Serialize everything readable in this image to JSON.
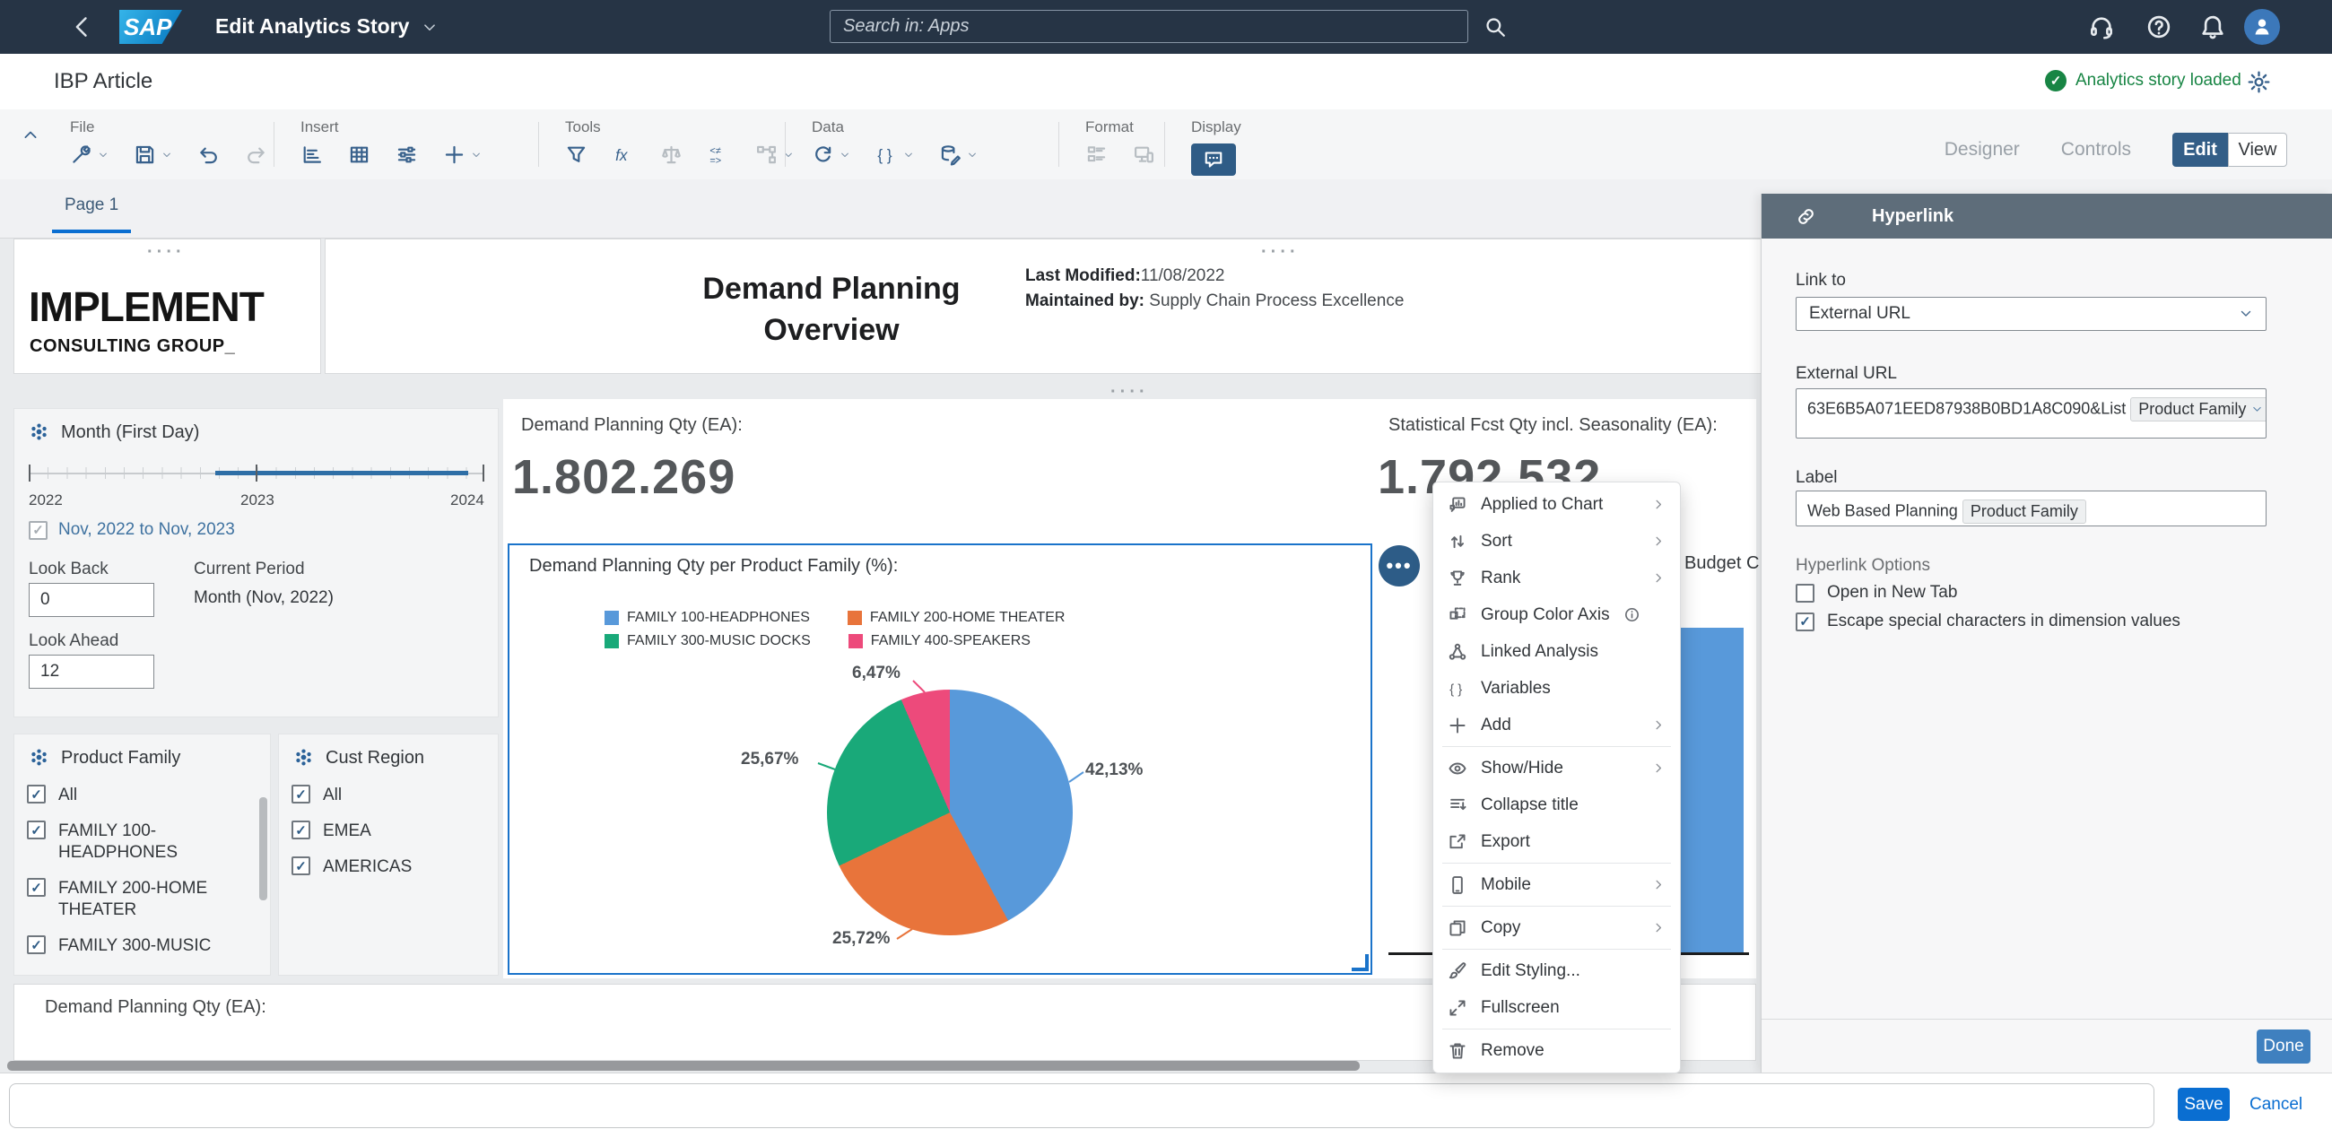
{
  "shell": {
    "title": "Edit Analytics Story",
    "search_placeholder": "Search in: Apps"
  },
  "header": {
    "story_title": "IBP Article",
    "status": "Analytics story loaded"
  },
  "toolbar": {
    "file": "File",
    "insert": "Insert",
    "tools": "Tools",
    "data": "Data",
    "format": "Format",
    "display": "Display",
    "designer": "Designer",
    "controls": "Controls",
    "edit": "Edit",
    "view": "View"
  },
  "tabs": {
    "page1": "Page 1"
  },
  "canvas": {
    "logo_line1": "IMPLEMENT",
    "logo_line2": "CONSULTING GROUP_",
    "title": "Demand Planning Overview",
    "last_modified_label": "Last Modified:",
    "last_modified_value": "11/08/2022",
    "maintained_label": "Maintained by:",
    "maintained_value": "Supply Chain Process Excellence",
    "kpi_left_label": "Demand Planning Qty (EA):",
    "kpi_left_value": "1.802.269",
    "kpi_right_label": "Statistical Fcst Qty incl. Seasonality (EA):",
    "kpi_right_value": "1.792.532",
    "partial_widget_title": "Budget C",
    "bottom_widget_title": "Demand Planning Qty (EA):"
  },
  "filters": {
    "month": {
      "title": "Month (First Day)",
      "ticks": [
        "2022",
        "2023",
        "2024"
      ],
      "range_label": "Nov, 2022 to Nov, 2023",
      "look_back_label": "Look Back",
      "look_back_value": "0",
      "current_period_label": "Current Period",
      "current_period_value": "Month (Nov, 2022)",
      "look_ahead_label": "Look Ahead",
      "look_ahead_value": "12"
    },
    "product_family": {
      "title": "Product Family",
      "items": [
        {
          "label": "All",
          "checked": true
        },
        {
          "label": "FAMILY 100-HEADPHONES",
          "checked": true
        },
        {
          "label": "FAMILY 200-HOME THEATER",
          "checked": true
        },
        {
          "label": "FAMILY 300-MUSIC",
          "checked": true
        }
      ]
    },
    "cust_region": {
      "title": "Cust Region",
      "items": [
        {
          "label": "All",
          "checked": true
        },
        {
          "label": "EMEA",
          "checked": true
        },
        {
          "label": "AMERICAS",
          "checked": true
        }
      ]
    }
  },
  "chart_data": {
    "type": "pie",
    "title": "Demand Planning Qty per Product Family (%):",
    "categories": [
      "FAMILY 100-HEADPHONES",
      "FAMILY 200-HOME THEATER",
      "FAMILY 300-MUSIC DOCKS",
      "FAMILY 400-SPEAKERS"
    ],
    "values": [
      42.13,
      25.72,
      25.67,
      6.47
    ],
    "labels": [
      "42,13%",
      "25,72%",
      "25,67%",
      "6,47%"
    ],
    "colors": [
      "#5899DA",
      "#E8743B",
      "#19A979",
      "#ED4A7B"
    ],
    "legend_position": "top",
    "start_angle": "top-clockwise"
  },
  "context_menu": {
    "items": [
      {
        "label": "Applied to Chart",
        "icon": "applied-chart",
        "submenu": true
      },
      {
        "label": "Sort",
        "icon": "sort",
        "submenu": true
      },
      {
        "label": "Rank",
        "icon": "rank",
        "submenu": true
      },
      {
        "label": "Group Color Axis",
        "icon": "group-color",
        "info": true
      },
      {
        "label": "Linked Analysis",
        "icon": "linked-analysis"
      },
      {
        "label": "Variables",
        "icon": "variables"
      },
      {
        "label": "Add",
        "icon": "add",
        "submenu": true,
        "divider": true
      },
      {
        "label": "Show/Hide",
        "icon": "show-hide",
        "submenu": true
      },
      {
        "label": "Collapse title",
        "icon": "collapse-title"
      },
      {
        "label": "Export",
        "icon": "export",
        "divider": true
      },
      {
        "label": "Mobile",
        "icon": "mobile",
        "submenu": true,
        "divider": true
      },
      {
        "label": "Copy",
        "icon": "copy",
        "submenu": true,
        "divider": true
      },
      {
        "label": "Edit Styling...",
        "icon": "edit-styling"
      },
      {
        "label": "Fullscreen",
        "icon": "fullscreen",
        "divider": true
      },
      {
        "label": "Remove",
        "icon": "remove"
      }
    ]
  },
  "hyperlink_panel": {
    "title": "Hyperlink",
    "link_to_label": "Link to",
    "link_to_value": "External URL",
    "external_url_label": "External URL",
    "external_url_value": "63E6B5A071EED87938B0BD1A8C090&List",
    "external_url_token": "Product Family",
    "label_label": "Label",
    "label_value": "Web Based Planning",
    "label_token": "Product Family",
    "options_label": "Hyperlink Options",
    "option_new_tab": "Open in New Tab",
    "option_new_tab_checked": false,
    "option_escape": "Escape special characters in dimension values",
    "option_escape_checked": true,
    "done": "Done"
  },
  "footer": {
    "save": "Save",
    "cancel": "Cancel"
  }
}
